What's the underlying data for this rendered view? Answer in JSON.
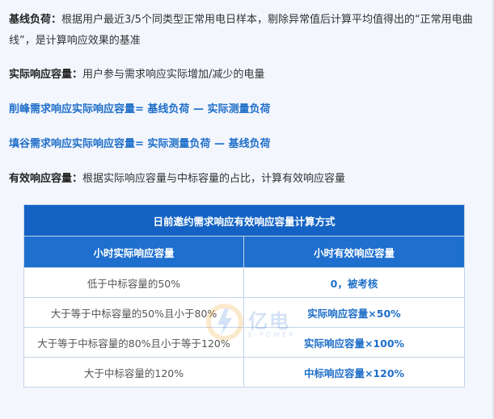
{
  "paragraphs": {
    "baseline_term": "基线负荷：",
    "baseline_text": "根据用户最近3/5个同类型正常用电日样本，剔除异常值后计算平均值得出的“正常用电曲线”，是计算响应效果的基准",
    "actual_term": "实际响应容量：",
    "actual_text": "用户参与需求响应实际增加/减少的电量",
    "peak_formula": "削峰需求响应实际响应容量= 基线负荷 — 实际测量负荷",
    "valley_formula": "填谷需求响应实际响应容量= 实际测量负荷 — 基线负荷",
    "effective_term": "有效响应容量：",
    "effective_text": "根据实际响应容量与中标容量的占比，计算有效响应容量"
  },
  "table": {
    "title": "日前邀约需求响应有效响应容量计算方式",
    "headers": [
      "小时实际响应容量",
      "小时有效响应容量"
    ],
    "rows": [
      [
        "低于中标容量的50%",
        "0，被考核"
      ],
      [
        "大于等于中标容量的50%且小于80%",
        "实际响应容量×50%"
      ],
      [
        "大于等于中标容量的80%且小于等于120%",
        "实际响应容量×100%"
      ],
      [
        "大于中标容量的120%",
        "中标响应容量×120%"
      ]
    ]
  },
  "watermark": {
    "text": "亿电",
    "sub": "E-POWER"
  }
}
